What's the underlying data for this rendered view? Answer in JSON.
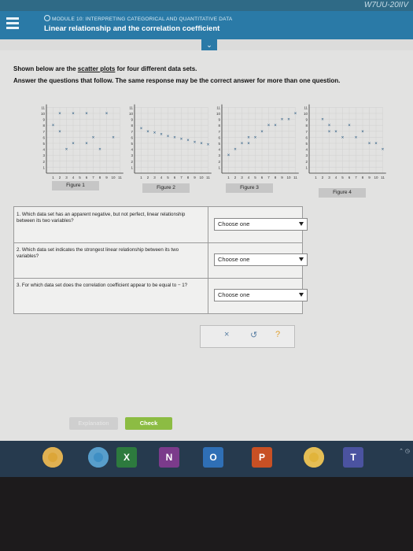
{
  "window": {
    "id_fragment": "W7UU-20IIV"
  },
  "header": {
    "breadcrumb": "MODULE 10: INTERPRETING CATEGORICAL AND QUANTITATIVE DATA",
    "title": "Linear relationship and the correlation coefficient",
    "collapse_glyph": "⌄"
  },
  "intro": {
    "line1_prefix": "Shown below are the ",
    "line1_link": "scatter plots",
    "line1_suffix": " for four different data sets.",
    "line2": "Answer the questions that follow. The same response may be the correct answer for more than one question."
  },
  "figures": [
    {
      "label": "Figure 1",
      "y_ticks": [
        "11",
        "10",
        "9",
        "8",
        "7",
        "6",
        "5",
        "4",
        "3",
        "2",
        "1"
      ],
      "x_ticks": [
        "1",
        "2",
        "3",
        "4",
        "5",
        "6",
        "7",
        "8",
        "9",
        "10",
        "11"
      ],
      "points": [
        [
          2,
          10
        ],
        [
          4,
          10
        ],
        [
          6,
          10
        ],
        [
          9,
          10
        ],
        [
          1,
          8
        ],
        [
          2,
          7
        ],
        [
          7,
          6
        ],
        [
          4,
          5
        ],
        [
          10,
          6
        ],
        [
          6,
          5
        ],
        [
          3,
          4
        ],
        [
          8,
          4
        ]
      ]
    },
    {
      "label": "Figure 2",
      "y_ticks": [
        "11",
        "10",
        "9",
        "8",
        "7",
        "6",
        "5",
        "4",
        "3",
        "2",
        "1"
      ],
      "x_ticks": [
        "1",
        "2",
        "3",
        "4",
        "5",
        "6",
        "7",
        "8",
        "9",
        "10",
        "11"
      ],
      "points": [
        [
          1,
          7.5
        ],
        [
          2,
          7
        ],
        [
          3,
          6.8
        ],
        [
          4,
          6.5
        ],
        [
          5,
          6.2
        ],
        [
          6,
          6
        ],
        [
          7,
          5.7
        ],
        [
          8,
          5.5
        ],
        [
          9,
          5.2
        ],
        [
          10,
          5
        ],
        [
          11,
          4.8
        ]
      ]
    },
    {
      "label": "Figure 3",
      "y_ticks": [
        "11",
        "10",
        "9",
        "8",
        "7",
        "6",
        "5",
        "4",
        "3",
        "2",
        "1"
      ],
      "x_ticks": [
        "1",
        "2",
        "3",
        "4",
        "5",
        "6",
        "7",
        "8",
        "9",
        "10",
        "11"
      ],
      "points": [
        [
          1,
          3
        ],
        [
          2,
          4
        ],
        [
          3,
          5
        ],
        [
          4,
          6
        ],
        [
          4,
          5
        ],
        [
          5,
          6
        ],
        [
          6,
          7
        ],
        [
          7,
          8
        ],
        [
          8,
          8
        ],
        [
          9,
          9
        ],
        [
          10,
          9
        ],
        [
          11,
          10
        ]
      ]
    },
    {
      "label": "Figure 4",
      "y_ticks": [
        "11",
        "10",
        "9",
        "8",
        "7",
        "6",
        "5",
        "4",
        "3",
        "2",
        "1"
      ],
      "x_ticks": [
        "1",
        "2",
        "3",
        "4",
        "5",
        "6",
        "7",
        "8",
        "9",
        "10",
        "11"
      ],
      "points": [
        [
          2,
          9
        ],
        [
          3,
          8
        ],
        [
          4,
          7
        ],
        [
          6,
          8
        ],
        [
          8,
          7
        ],
        [
          5,
          6
        ],
        [
          7,
          6
        ],
        [
          9,
          5
        ],
        [
          10,
          5
        ],
        [
          11,
          4
        ],
        [
          3,
          7
        ]
      ]
    }
  ],
  "questions": [
    {
      "text": "1. Which data set has an apparent negative, but not perfect, linear relationship between its two variables?",
      "select": "Choose one"
    },
    {
      "text": "2. Which data set indicates the strongest linear relationship between its two variables?",
      "select": "Choose one"
    },
    {
      "text": "3. For which data set does the correlation coefficient appear to be equal to − 1?",
      "select": "Choose one"
    }
  ],
  "tools": {
    "clear": "×",
    "undo": "↺",
    "help": "?"
  },
  "actions": {
    "explanation": "Explanation",
    "check": "Check"
  },
  "taskbar": {
    "apps": [
      {
        "name": "chrome-icon",
        "color": "#dca638"
      },
      {
        "name": "chrome-icon-2",
        "color": "#3f8fc4"
      },
      {
        "name": "excel-icon",
        "color": "#2d7a3e",
        "glyph": "X"
      },
      {
        "name": "onenote-icon",
        "color": "#7b3b8b",
        "glyph": "N"
      },
      {
        "name": "outlook-icon",
        "color": "#2f6fb5",
        "glyph": "O"
      },
      {
        "name": "powerpoint-icon",
        "color": "#c85024",
        "glyph": "P"
      },
      {
        "name": "chrome-icon-3",
        "color": "#e1b43b"
      },
      {
        "name": "teams-icon",
        "color": "#4b53a0",
        "glyph": "T"
      }
    ]
  }
}
